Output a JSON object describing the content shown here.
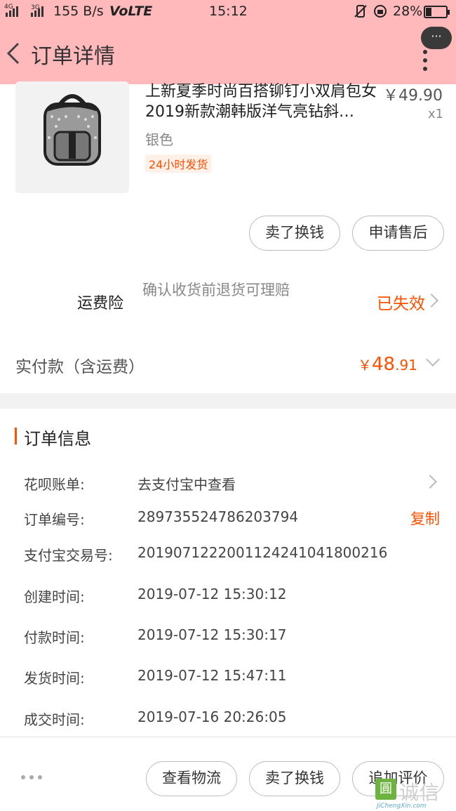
{
  "status_bar": {
    "net1": "4G",
    "net2": "3G",
    "speed": "155 B/s",
    "volte": "VoLTE",
    "time": "15:12",
    "battery": "28%",
    "battery_level": 0.28
  },
  "header": {
    "back_icon": "chevron-left-icon",
    "title": "订单详情",
    "more_bubble": "···"
  },
  "product": {
    "title": "上新夏季时尚百搭铆钉小双肩包女2019新款潮韩版洋气亮钻斜…",
    "price": "￥49.90",
    "quantity": "x1",
    "sku": "银色",
    "tag": "24小时发货"
  },
  "item_actions": {
    "sell": "卖了换钱",
    "after_sale": "申请售后"
  },
  "insurance": {
    "label": "运费险",
    "description": "确认收货前退货可理赔",
    "status": "已失效"
  },
  "payment": {
    "label": "实付款（含运费）",
    "currency": "￥",
    "amount_int": "48",
    "amount_dec": ".91"
  },
  "order_info": {
    "title": "订单信息",
    "rows": [
      {
        "label": "花呗账单:",
        "value": "去支付宝中查看"
      },
      {
        "label": "订单编号:",
        "value": "289735524786203794"
      },
      {
        "label": "支付宝交易号:",
        "value": "2019071222001124241041800216"
      },
      {
        "label": "创建时间:",
        "value": "2019-07-12 15:30:12"
      },
      {
        "label": "付款时间:",
        "value": "2019-07-12 15:30:17"
      },
      {
        "label": "发货时间:",
        "value": "2019-07-12 15:47:11"
      },
      {
        "label": "成交时间:",
        "value": "2019-07-16 20:26:05"
      }
    ],
    "copy_label": "复制"
  },
  "bottom_bar": {
    "logistics": "查看物流",
    "sell": "卖了换钱",
    "review": "追加评价"
  },
  "watermark": {
    "box": "圓",
    "text": "诚信",
    "url": "JiChengXin.com"
  },
  "colors": {
    "header_bg": "#ffb9bb",
    "accent": "#ff5000"
  }
}
